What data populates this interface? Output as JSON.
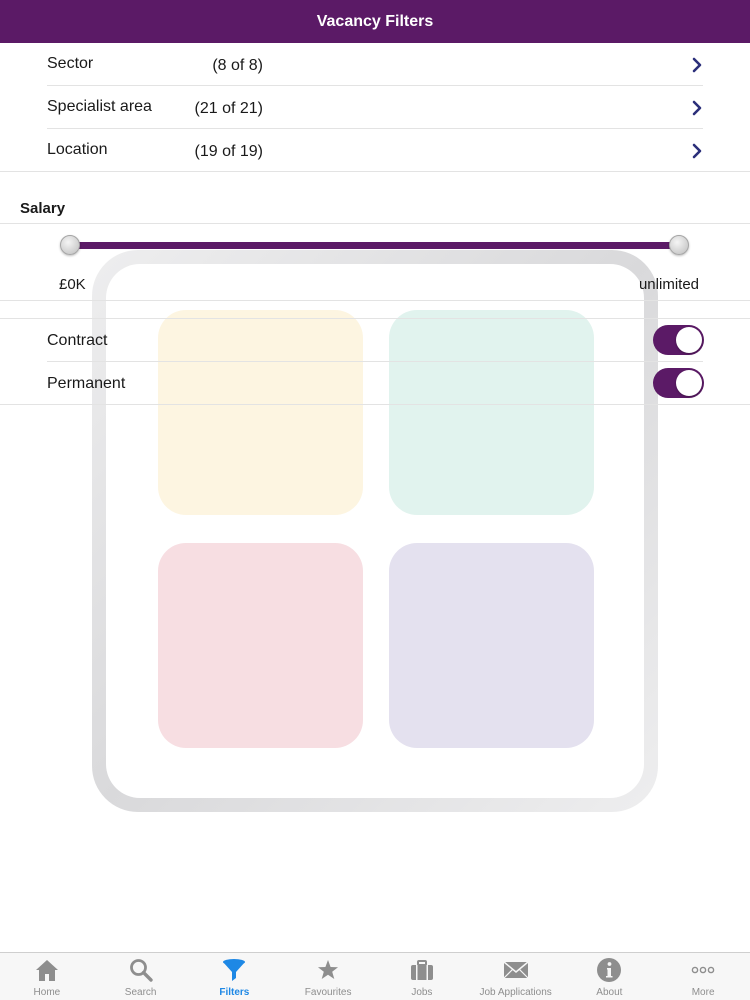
{
  "header": {
    "title": "Vacancy Filters"
  },
  "filters": [
    {
      "label": "Sector",
      "count": "(8 of 8)"
    },
    {
      "label": "Specialist area",
      "count": "(21 of 21)"
    },
    {
      "label": "Location",
      "count": "(19 of 19)"
    }
  ],
  "salary": {
    "title": "Salary",
    "min_label": "£0K",
    "max_label": "unlimited",
    "min_fraction": 0,
    "max_fraction": 1
  },
  "contract_types": [
    {
      "label": "Contract",
      "enabled": true
    },
    {
      "label": "Permanent",
      "enabled": true
    }
  ],
  "tabs": [
    {
      "label": "Home",
      "icon": "home-icon",
      "active": false
    },
    {
      "label": "Search",
      "icon": "search-icon",
      "active": false
    },
    {
      "label": "Filters",
      "icon": "funnel-icon",
      "active": true
    },
    {
      "label": "Favourites",
      "icon": "star-icon",
      "active": false
    },
    {
      "label": "Jobs",
      "icon": "briefcase-icon",
      "active": false
    },
    {
      "label": "Job Applications",
      "icon": "envelope-icon",
      "active": false
    },
    {
      "label": "About",
      "icon": "info-icon",
      "active": false
    },
    {
      "label": "More",
      "icon": "more-icon",
      "active": false
    }
  ],
  "colors": {
    "brand": "#5b1a66",
    "active_tab": "#1e88e5",
    "inactive_tab": "#8e8e8e"
  }
}
